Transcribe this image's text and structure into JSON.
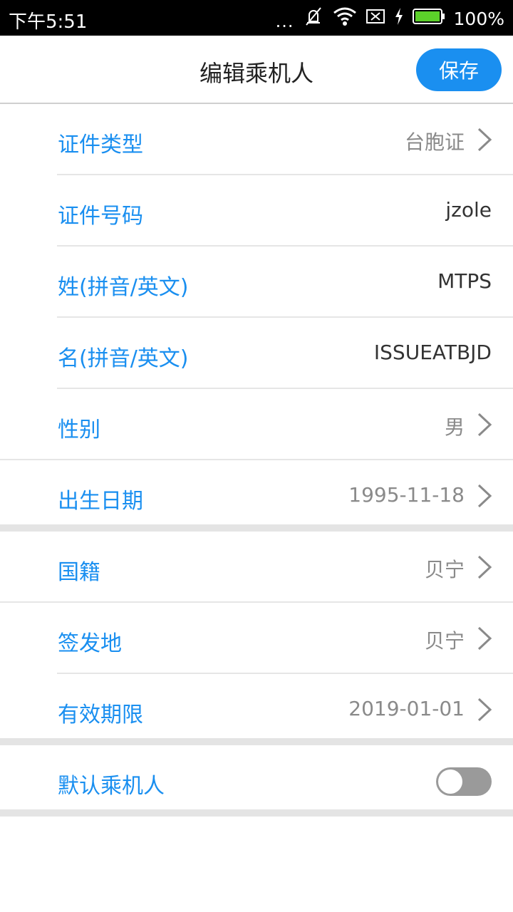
{
  "status": {
    "time": "下午5:51",
    "dots": "...",
    "battery_text": "100%",
    "battery_color": "#5cd12a"
  },
  "header": {
    "title": "编辑乘机人",
    "save_label": "保存"
  },
  "colors": {
    "accent": "#1a8ff0",
    "label": "#1a8ff0",
    "gray_value": "#8a8a8a"
  },
  "form": {
    "doc_type": {
      "label": "证件类型",
      "value": "台胞证"
    },
    "doc_number": {
      "label": "证件号码",
      "value": "jzole"
    },
    "surname": {
      "label": "姓(拼音/英文)",
      "value": "MTPS"
    },
    "given_name": {
      "label": "名(拼音/英文)",
      "value": "ISSUEATBJD"
    },
    "gender": {
      "label": "性别",
      "value": "男"
    },
    "birth_date": {
      "label": "出生日期",
      "value": "1995-11-18"
    },
    "nationality": {
      "label": "国籍",
      "value": "贝宁"
    },
    "issue_place": {
      "label": "签发地",
      "value": "贝宁"
    },
    "expiry": {
      "label": "有效期限",
      "value": "2019-01-01"
    },
    "default_passenger": {
      "label": "默认乘机人",
      "toggle_on": false
    }
  }
}
